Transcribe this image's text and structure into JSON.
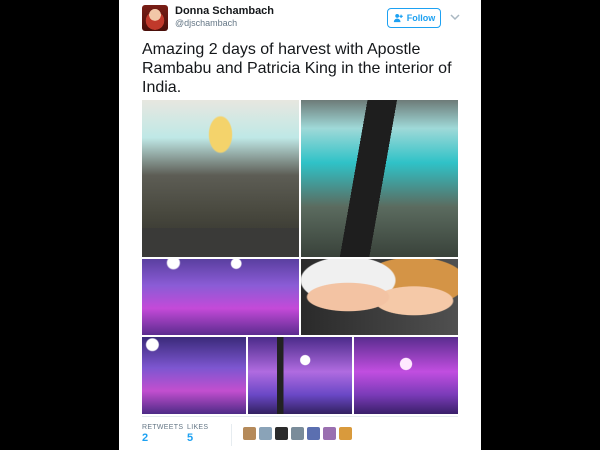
{
  "tweet": {
    "author_name": "Donna Schambach",
    "author_handle": "@djschambach",
    "follow_label": "Follow",
    "text": "Amazing 2 days of harvest with Apostle Rambabu and Patricia King in the interior of India."
  },
  "stats": {
    "retweets_label": "RETWEETS",
    "retweets_count": "2",
    "likes_label": "LIKES",
    "likes_count": "5"
  },
  "likers": [
    "#b58a5a",
    "#8aa3b8",
    "#2b2b2b",
    "#7a8c9a",
    "#5b6fb0",
    "#9a6fb0",
    "#d99a3c"
  ],
  "colors": {
    "accent": "#1da1f2",
    "text": "#14171a",
    "muted": "#657786",
    "background": "#000000"
  },
  "icons": [
    "add-user-icon",
    "chevron-down-icon"
  ]
}
